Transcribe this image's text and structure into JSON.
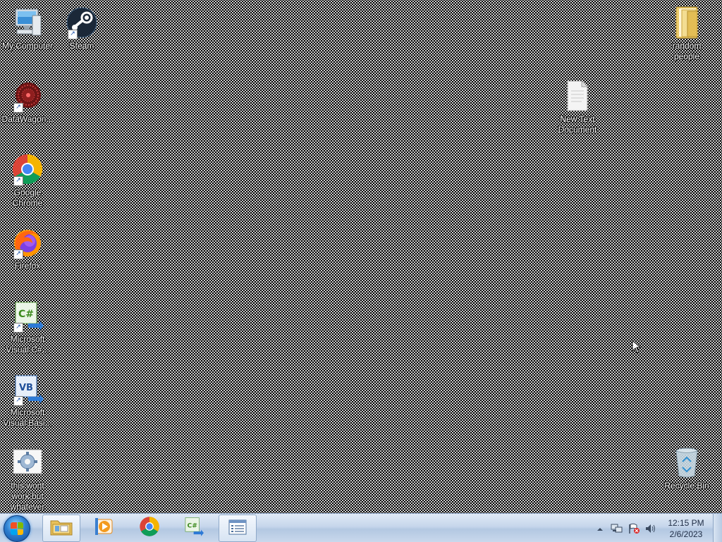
{
  "desktop": {
    "icons": [
      {
        "label": "My Computer",
        "icon": "computer-icon"
      },
      {
        "label": "Steam",
        "icon": "steam-icon"
      },
      {
        "label": "random\npeople",
        "icon": "folder-icon"
      },
      {
        "label": "DataWagon...",
        "icon": "datawagon-icon"
      },
      {
        "label": "New Text\nDocument",
        "icon": "text-document-icon"
      },
      {
        "label": "Google\nChrome",
        "icon": "chrome-icon"
      },
      {
        "label": "Firefox",
        "icon": "firefox-icon"
      },
      {
        "label": "Microsoft\nVisual C#...",
        "icon": "visual-csharp-icon"
      },
      {
        "label": "Microsoft\nVisual Basi...",
        "icon": "visual-basic-icon"
      },
      {
        "label": "this wont\nwork but\nwhatever",
        "icon": "settings-document-icon"
      },
      {
        "label": "Recycle Bin",
        "icon": "recycle-bin-icon"
      }
    ]
  },
  "taskbar": {
    "start": {
      "icon": "windows-start-icon"
    },
    "pinned": [
      {
        "icon": "file-explorer-icon",
        "active": true
      },
      {
        "icon": "media-player-icon",
        "active": false
      },
      {
        "icon": "chrome-icon",
        "active": false
      },
      {
        "icon": "visual-csharp-icon",
        "active": false
      },
      {
        "icon": "list-window-icon",
        "active": true
      }
    ],
    "tray": {
      "icons": [
        "show-hidden-icons-chevron",
        "network-icon",
        "action-center-flag-icon",
        "volume-icon"
      ],
      "time": "12:15 PM",
      "date": "2/6/2023"
    }
  },
  "colors": {
    "desktop_background": "#000000",
    "taskbar_top": "#dfe9f5",
    "taskbar_bottom": "#b3c8e2"
  }
}
